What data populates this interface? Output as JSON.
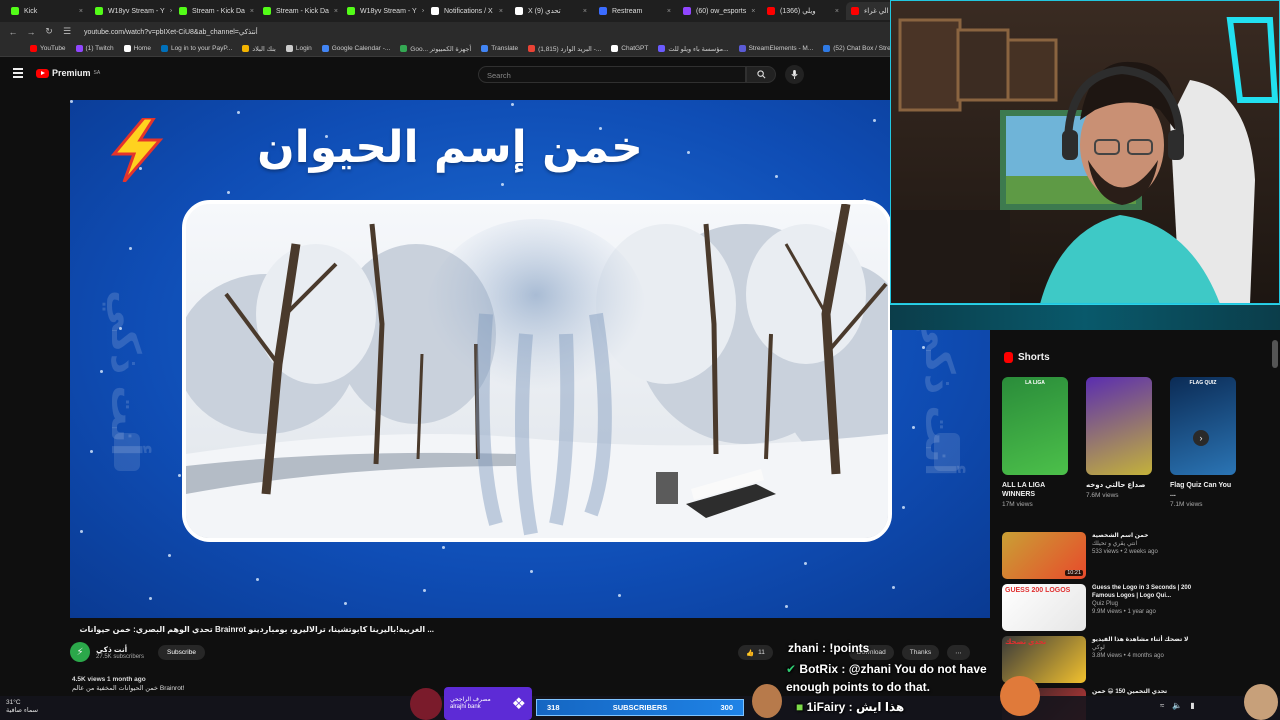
{
  "browser": {
    "tabs": [
      {
        "label": "Kick",
        "color": "#53fc18",
        "active": false
      },
      {
        "label": "W18yv Stream - Y",
        "color": "#53fc18",
        "active": false
      },
      {
        "label": "Stream - Kick Da",
        "color": "#53fc18",
        "active": false
      },
      {
        "label": "Stream - Kick Da",
        "color": "#53fc18",
        "active": false
      },
      {
        "label": "W18yv Stream - Y",
        "color": "#53fc18",
        "active": false
      },
      {
        "label": "Notifications / X",
        "color": "#ffffff",
        "active": false
      },
      {
        "label": "X (9) تحدي",
        "color": "#ffffff",
        "active": false
      },
      {
        "label": "Restream",
        "color": "#3b6cff",
        "active": false
      },
      {
        "label": "(60) ow_esports",
        "color": "#9146ff",
        "active": false
      },
      {
        "label": "(1366) ويلي",
        "color": "#ff0000",
        "active": false
      },
      {
        "label": "تحدي الي غراء",
        "color": "#ff0000",
        "active": true
      }
    ],
    "url": "youtube.com/watch?v=pbIXet-CiU8&ab_channel=أنتذكي",
    "bookmarks": [
      {
        "label": "YouTube",
        "color": "#ff0000"
      },
      {
        "label": "(1) Twitch",
        "color": "#9146ff"
      },
      {
        "label": "Home",
        "color": "#ffffff"
      },
      {
        "label": "Log in to your PayP...",
        "color": "#0070ba"
      },
      {
        "label": "بنك البلاد",
        "color": "#f2b300"
      },
      {
        "label": "Login",
        "color": "#cccccc"
      },
      {
        "label": "Google Calendar -...",
        "color": "#4285f4"
      },
      {
        "label": "Goo... أجهزة الكمبيوتر",
        "color": "#34a853"
      },
      {
        "label": "Translate",
        "color": "#4285f4"
      },
      {
        "label": "(1,815) البريد الوارد -...",
        "color": "#ea4335"
      },
      {
        "label": "ChatGPT",
        "color": "#ffffff"
      },
      {
        "label": "مؤسسة باء ويلو للت...",
        "color": "#6b5bff"
      },
      {
        "label": "StreamElements - M...",
        "color": "#5b5bd6"
      },
      {
        "label": "(52) Chat Box / Stre...",
        "color": "#2f7ae5"
      },
      {
        "label": "W18yv Stream - ...",
        "color": "#53fc18"
      }
    ]
  },
  "youtube": {
    "logo": "Premium",
    "region": "SA",
    "search_placeholder": "Search"
  },
  "video": {
    "overlay_title": "خمن إسم الحيوان",
    "side_text": "أنت ذكي",
    "title": "... الغريبة!باليرينا كابوتشينا، ترالاليرو، بومباردينو Brainrot تحدي الوهم البصري: خمن حيوانات",
    "channel": "أنت ذكي",
    "subscribers": "27.5K subscribers",
    "subscribe_label": "Subscribe",
    "likes": "11",
    "download_label": "Download",
    "thanks_label": "Thanks",
    "views_date": "4.5K views  1 month ago",
    "description_line": "خمن الحيوانات المخفية من عالم Brainrot!"
  },
  "sidebar": {
    "shorts_heading": "Shorts",
    "shorts": [
      {
        "title": "ALL LA LIGA WINNERS",
        "views": "17M views",
        "badge": "LA LIGA",
        "colors": [
          "#2a8c3a",
          "#4cc04a"
        ]
      },
      {
        "title": "صداع حالتي دوخه",
        "views": "7.6M views",
        "badge": "",
        "colors": [
          "#5a2db0",
          "#c4b23a"
        ]
      },
      {
        "title": "Flag Quiz Can You ...",
        "views": "7.1M views",
        "badge": "FLAG QUIZ",
        "colors": [
          "#0b2b55",
          "#2b75b5"
        ]
      }
    ],
    "videos": [
      {
        "title": "خمن اسم الشخصية",
        "channel": "انتي يقري و تحيلك",
        "meta": "533 views • 2 weeks ago",
        "duration": "10:21",
        "colors": [
          "#c9a035",
          "#e84a2b"
        ]
      },
      {
        "title": "Guess the Logo in 3 Seconds | 200 Famous Logos | Logo Qui...",
        "channel": "Quiz Plug",
        "meta": "9.9M views • 1 year ago",
        "duration": "",
        "badge": "GUESS 200 LOGOS",
        "colors": [
          "#ffffff",
          "#e6e6e6"
        ]
      },
      {
        "title": "لا تضحك أثناء مشاهدة هذا الفيديو",
        "channel": "لوكي",
        "meta": "3.8M views • 4 months ago",
        "duration": "",
        "badge": "تحدي تضحك",
        "colors": [
          "#3a3a3a",
          "#f2c12e"
        ]
      },
      {
        "title": "تحدي التخمين 150 😁 خمن",
        "channel": "",
        "meta": "",
        "duration": "",
        "colors": [
          "#222222",
          "#d23b3b"
        ]
      }
    ]
  },
  "overlays": {
    "chat": [
      {
        "text": "zhani : !points"
      },
      {
        "text": "BotRix : @zhani You do not have"
      },
      {
        "text": "enough points to do that."
      },
      {
        "text": "1iFairy : هذا ايش"
      }
    ],
    "subs_label": "SUBSCRIBERS",
    "subs_current": "318",
    "subs_goal": "300",
    "sponsor_text": "مصرف الراجحي\nalrajhi bank"
  },
  "taskbar": {
    "temperature": "31°C",
    "weather": "سماء صافية"
  }
}
